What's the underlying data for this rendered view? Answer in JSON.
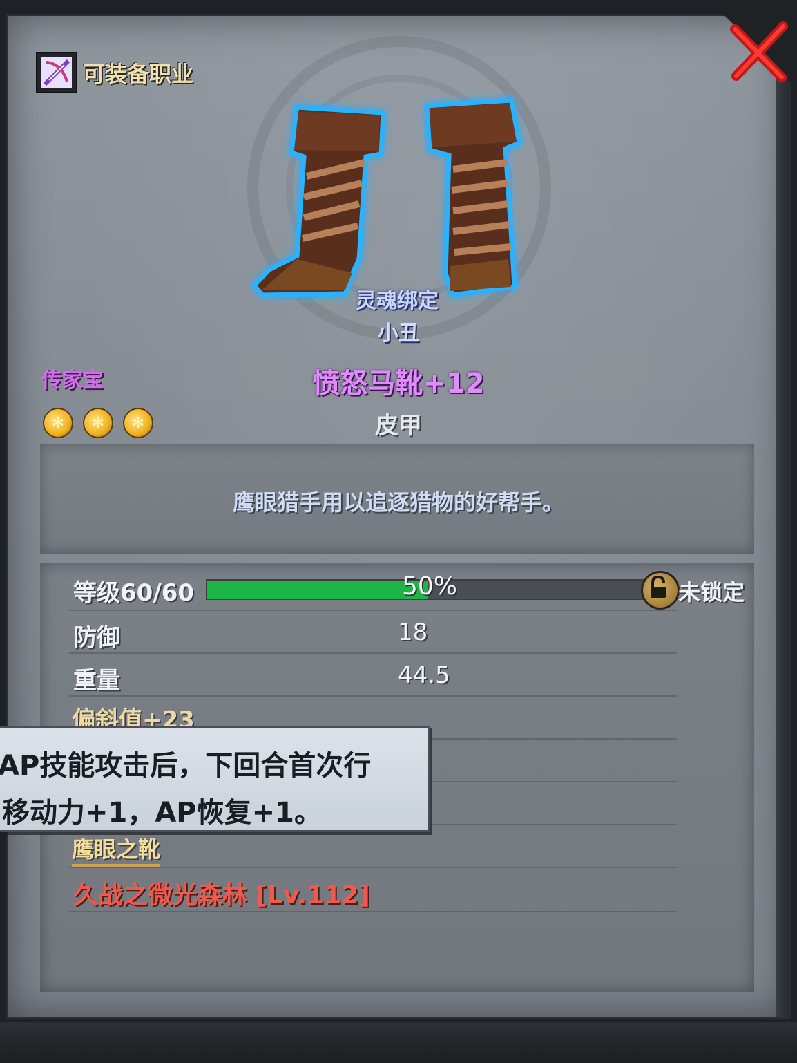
{
  "header": {
    "class_label": "可装备职业",
    "class_icon": "archer-class-icon"
  },
  "item": {
    "soulbound": "灵魂绑定",
    "class": "小丑",
    "rarity": "传家宝",
    "name": "愤怒马靴+12",
    "type": "皮甲",
    "stars": 3,
    "description": "鹰眼猎手用以追逐猎物的好帮手。"
  },
  "stats": {
    "level_label": "等级60/60",
    "level_percent_text": "50%",
    "level_progress": 0.5,
    "lock_label": "未锁定",
    "defense_label": "防御",
    "defense_value": "18",
    "weight_label": "重量",
    "weight_value": "44.5",
    "deviation": "偏斜值+23",
    "set_name": "鹰眼之靴",
    "source": "久战之微光森林 [Lv.112]"
  },
  "tooltip": {
    "line1": "AP技能攻击后，下回合首次行",
    "line2": "移动力+1，AP恢复+1。"
  },
  "colors": {
    "rarity": "#d46bf0",
    "name": "#e08cff",
    "progress": "#1fb446",
    "source": "#f05a4c",
    "close": "#d61c1c"
  }
}
